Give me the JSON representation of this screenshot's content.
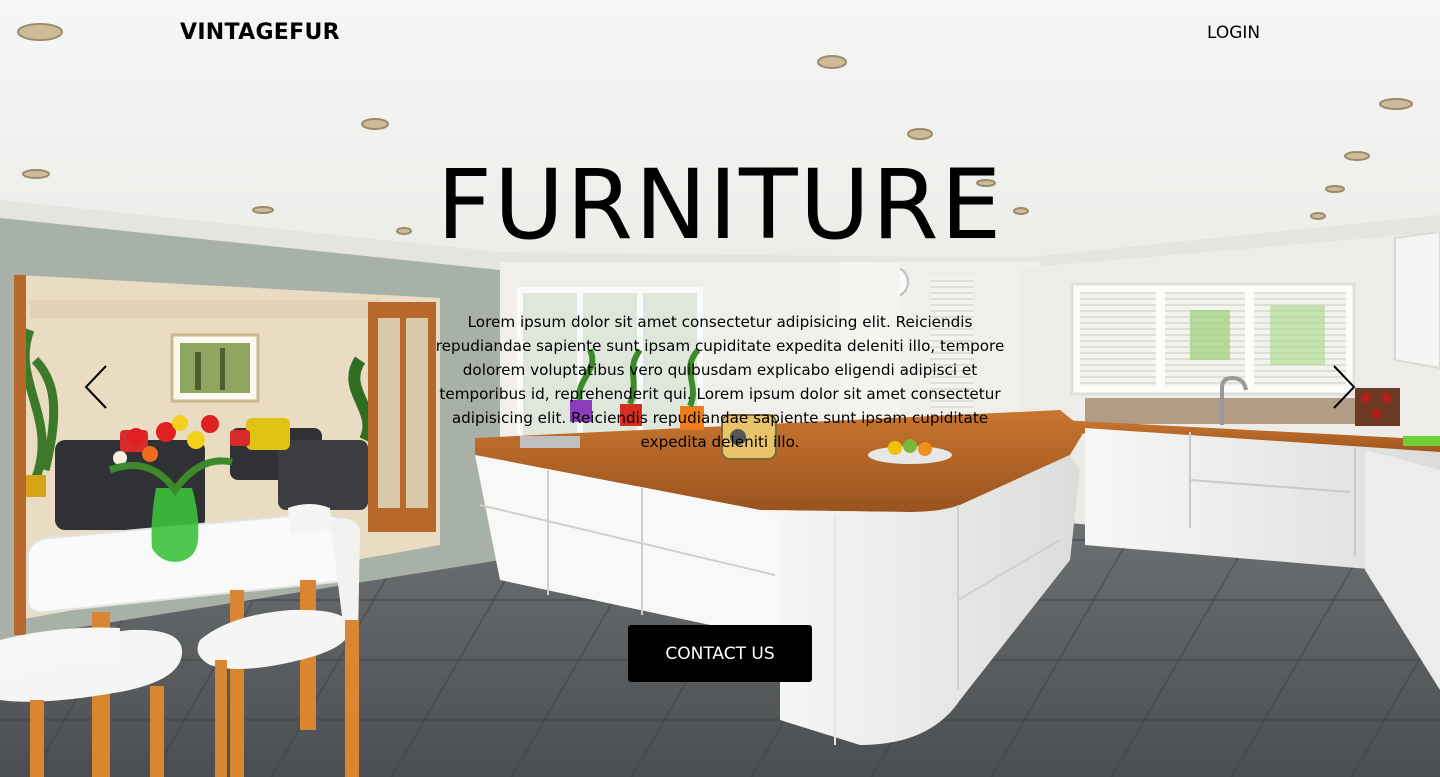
{
  "brand": {
    "logo_text": "VINTAGEFUR"
  },
  "nav": {
    "login_label": "LOGIN"
  },
  "hero": {
    "headline": "FURNITURE",
    "description": "Lorem ipsum dolor sit amet consectetur adipisicing elit. Reiciendis repudiandae sapiente sunt ipsam cupiditate expedita deleniti illo, tempore dolorem voluptatibus vero quibusdam explicabo eligendi adipisci et temporibus id, reprehenderit qui. Lorem ipsum dolor sit amet consectetur adipisicing elit. Reiciendis repudiandae sapiente sunt ipsam cupiditate expedita deleniti illo.",
    "cta_label": "CONTACT US",
    "prev_icon": "chevron-left-icon",
    "next_icon": "chevron-right-icon"
  },
  "colors": {
    "text": "#000000",
    "button_bg": "#000000",
    "button_text": "#ffffff",
    "countertop": "#b86a2c",
    "cabinet": "#f4f4f2",
    "floor_tile": "#5f6264",
    "wall": "#efeeea"
  }
}
